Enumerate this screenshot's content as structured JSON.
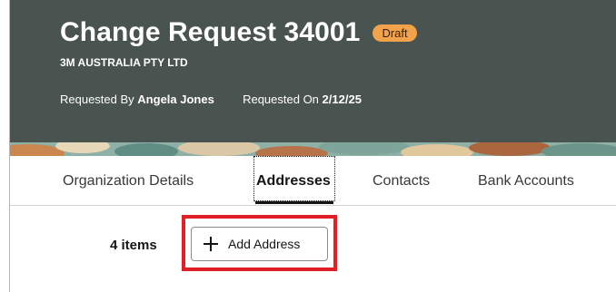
{
  "header": {
    "title": "Change Request 34001",
    "status": "Draft",
    "organization": "3M AUSTRALIA PTY LTD",
    "requested_by_label": "Requested By",
    "requested_by": "Angela Jones",
    "requested_on_label": "Requested On",
    "requested_on": "2/12/25"
  },
  "tabs": [
    {
      "label": "Organization Details"
    },
    {
      "label": "Addresses"
    },
    {
      "label": "Contacts"
    },
    {
      "label": "Bank Accounts"
    }
  ],
  "active_tab": "Addresses",
  "addresses": {
    "item_count": "4 items",
    "add_button_label": "Add Address"
  },
  "colors": {
    "header_bg": "#49534f",
    "draft_badge": "#f2a24a",
    "highlight": "#e31e24"
  }
}
